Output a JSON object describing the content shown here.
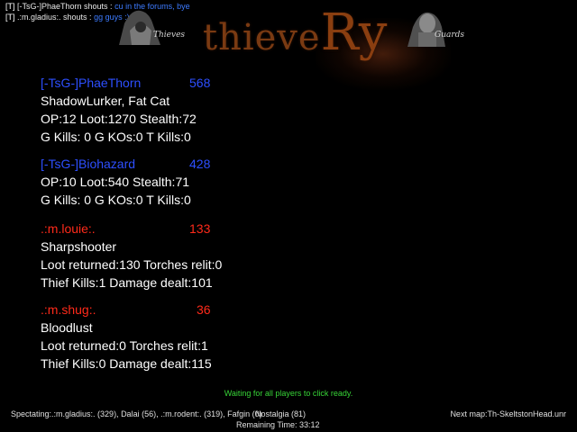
{
  "chat": [
    {
      "prefix": "[T]",
      "name": "[-TsG-]PhaeThorn shouts :",
      "message": "cu in the forums, bye"
    },
    {
      "prefix": "[T]",
      "name": ".:m.gladius:. shouts :",
      "message": "gg guys :)"
    }
  ],
  "logo": {
    "text_main": "thieve",
    "text_ry": "Ry",
    "left_label": "Thieves",
    "right_label": "Guards"
  },
  "players": [
    {
      "name": "[-TsG-]PhaeThorn",
      "score": "568",
      "line1": "ShadowLurker, Fat Cat",
      "line2": "OP:12   Loot:1270   Stealth:72",
      "line3": "G Kills: 0   G KOs:0   T Kills:0"
    },
    {
      "name": "[-TsG-]Biohazard",
      "score": "428",
      "line1": "OP:10   Loot:540   Stealth:71",
      "line2": "G Kills: 0   G KOs:0   T Kills:0",
      "line3": ""
    },
    {
      "name": ".:m.louie:.",
      "score": "133",
      "line1": "Sharpshooter",
      "line2": "Loot returned:130   Torches relit:0",
      "line3": "Thief Kills:1   Damage dealt:101"
    },
    {
      "name": ".:m.shug:.",
      "score": "36",
      "line1": "Bloodlust",
      "line2": "Loot returned:0   Torches relit:1",
      "line3": "Thief Kills:0   Damage dealt:115"
    }
  ],
  "status": {
    "waiting": "Waiting for all players to click ready.",
    "spectating": "Spectating:.:m.gladius:. (329), Dalai (56), .:m.rodent:. (319), Fafgin (0)",
    "overlay_name": "Nostalgia (81)",
    "next_map": "Next map:Th-SkeltstonHead.unr",
    "remaining": "Remaining Time:  33:12"
  },
  "colors": {
    "team_blue": "#2d4fff",
    "team_red": "#ff2a1a",
    "waiting_text": "#37d437",
    "chat_message": "#3d7bff"
  }
}
